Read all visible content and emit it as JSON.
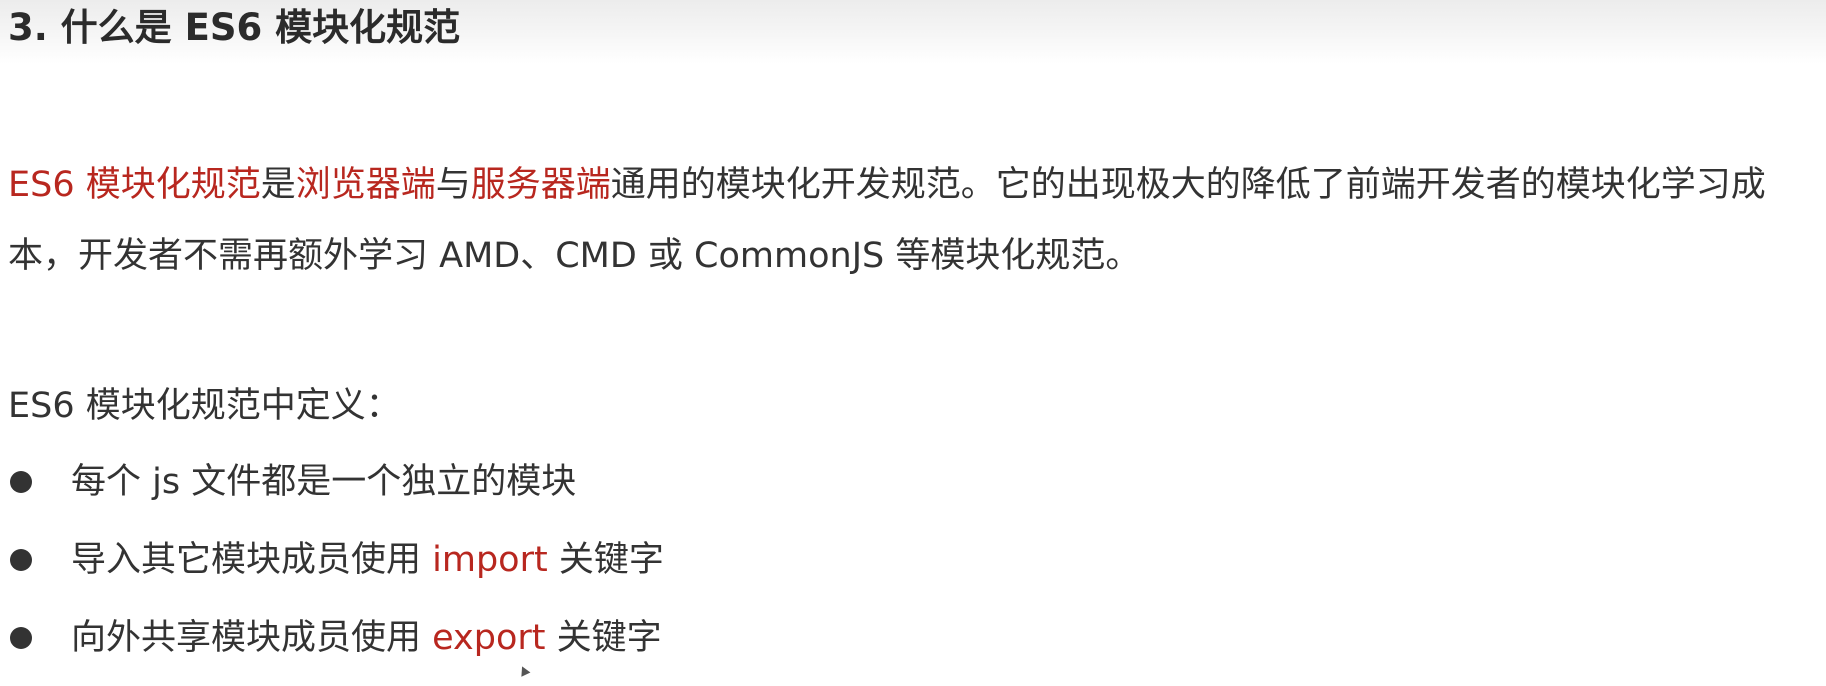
{
  "heading": {
    "title": "3. 什么是 ES6 模块化规范"
  },
  "intro_paragraph": {
    "term_es6": "ES6 模块化规范",
    "connector_is": "是",
    "term_browser": "浏览器端",
    "connector_and": "与",
    "term_server": "服务器端",
    "rest": "通用的模块化开发规范。它的出现极大的降低了前端开发者的模块化学习成本，开发者不需再额外学习 AMD、CMD 或 CommonJS 等模块化规范。"
  },
  "definitions": {
    "intro": "ES6 模块化规范中定义：",
    "items": [
      {
        "text": "每个 js 文件都是一个独立的模块",
        "keyword": "",
        "suffix": ""
      },
      {
        "text": "导入其它模块成员使用 ",
        "keyword": "import",
        "suffix": " 关键字"
      },
      {
        "text": "向外共享模块成员使用 ",
        "keyword": "export",
        "suffix": " 关键字"
      }
    ]
  },
  "colors": {
    "accent_red": "#b8271f",
    "text": "#333333",
    "header_gradient_top": "#ececec"
  }
}
